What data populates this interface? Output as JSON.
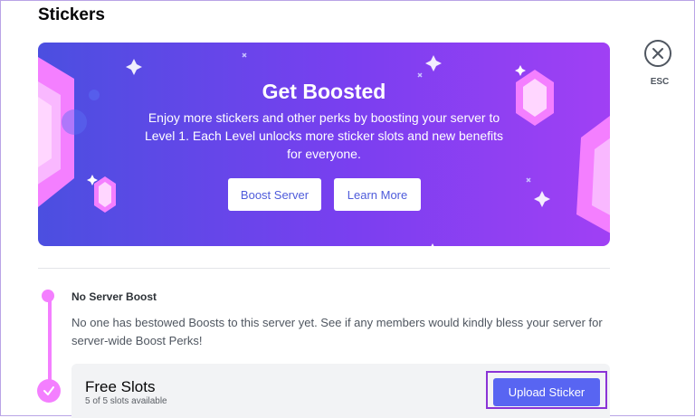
{
  "page": {
    "title": "Stickers"
  },
  "close": {
    "label": "ESC",
    "icon": "close-icon"
  },
  "banner": {
    "heading": "Get Boosted",
    "text": "Enjoy more stickers and other perks by boosting your server to Level 1. Each Level unlocks more sticker slots and new benefits for everyone.",
    "boost_button": "Boost Server",
    "learn_button": "Learn More",
    "colors": {
      "gradient_start": "#4b4fe0",
      "gradient_end": "#a040f4",
      "gem": "#f47fff"
    }
  },
  "tier": {
    "title": "No Server Boost",
    "description": "No one has bestowed Boosts to this server yet. See if any members would kindly bless your server for server-wide Boost Perks!"
  },
  "free_slots": {
    "title": "Free Slots",
    "subtitle": "5 of 5 slots available",
    "upload_button": "Upload Sticker"
  },
  "colors": {
    "accent": "#5865f2",
    "timeline": "#f47fff",
    "highlight_outline": "#8a33d6"
  }
}
